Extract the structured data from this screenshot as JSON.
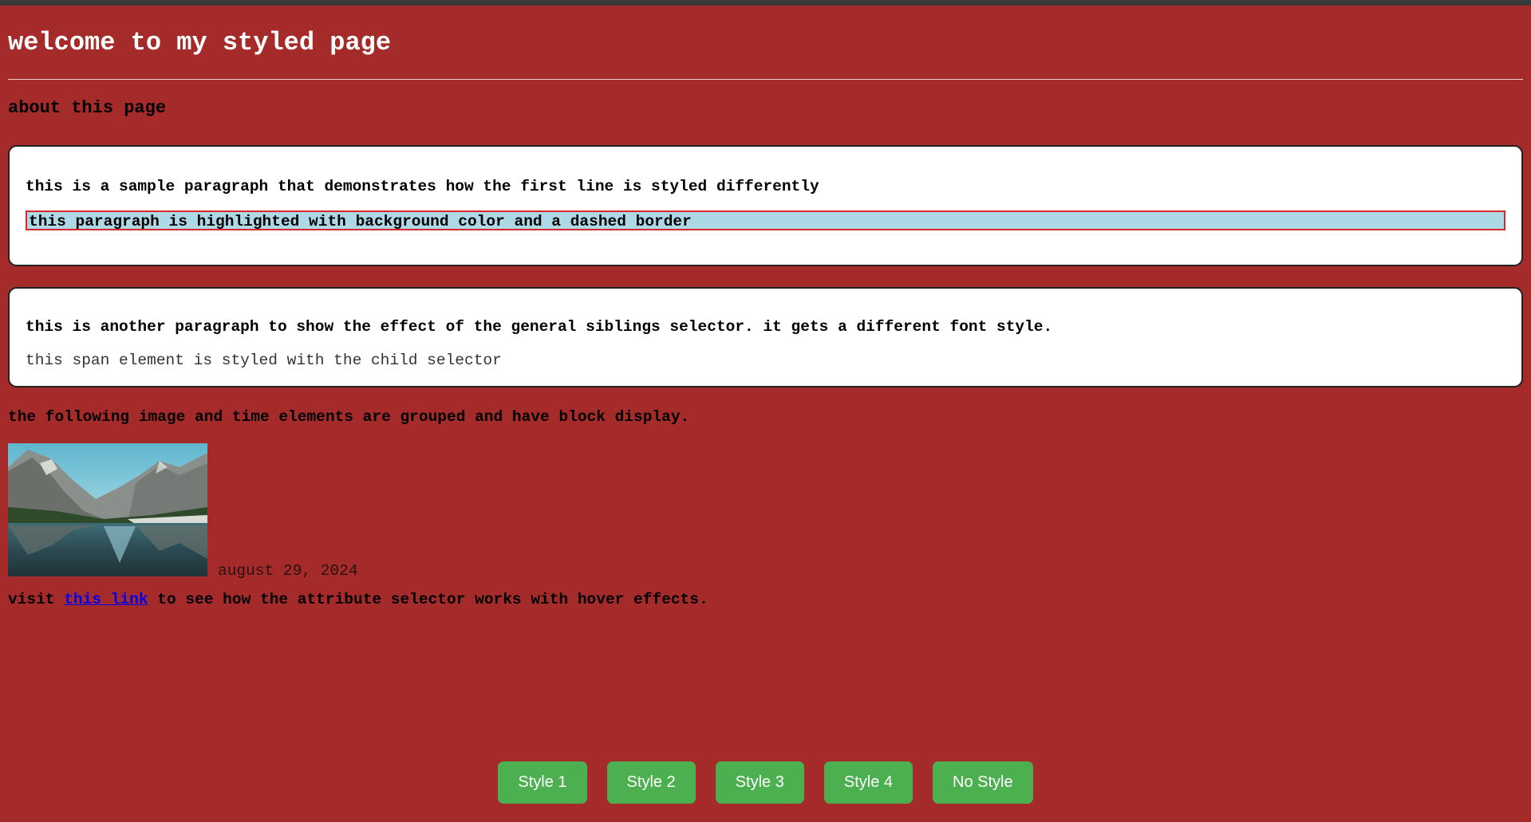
{
  "page": {
    "heading": "welcome to my styled page",
    "subheading": "about this page"
  },
  "card_one": {
    "first_paragraph": "this is a sample paragraph that demonstrates how the first line is styled differently",
    "highlighted_paragraph": "this paragraph is highlighted with background color and a dashed border"
  },
  "card_two": {
    "sibling_paragraph": "this is another paragraph to show the effect of the general siblings selector. it gets a different font style.",
    "child_span": "this span element is styled with the child selector"
  },
  "grouped_section": {
    "intro": "the following image and time elements are grouped and have block display.",
    "image_alt": "mountain lake landscape",
    "date": "august 29, 2024"
  },
  "link_section": {
    "before": "visit ",
    "link_text": "this link",
    "after": " to see how the attribute selector works with hover effects."
  },
  "buttons": [
    {
      "label": "Style 1"
    },
    {
      "label": "Style 2"
    },
    {
      "label": "Style 3"
    },
    {
      "label": "Style 4"
    },
    {
      "label": "No Style"
    }
  ],
  "colors": {
    "page_background": "#a52a2a",
    "card_background": "#ffffff",
    "highlight_background": "#add8e6",
    "highlight_border": "#d9262b",
    "button_background": "#4caf50",
    "link": "#0000ee"
  }
}
